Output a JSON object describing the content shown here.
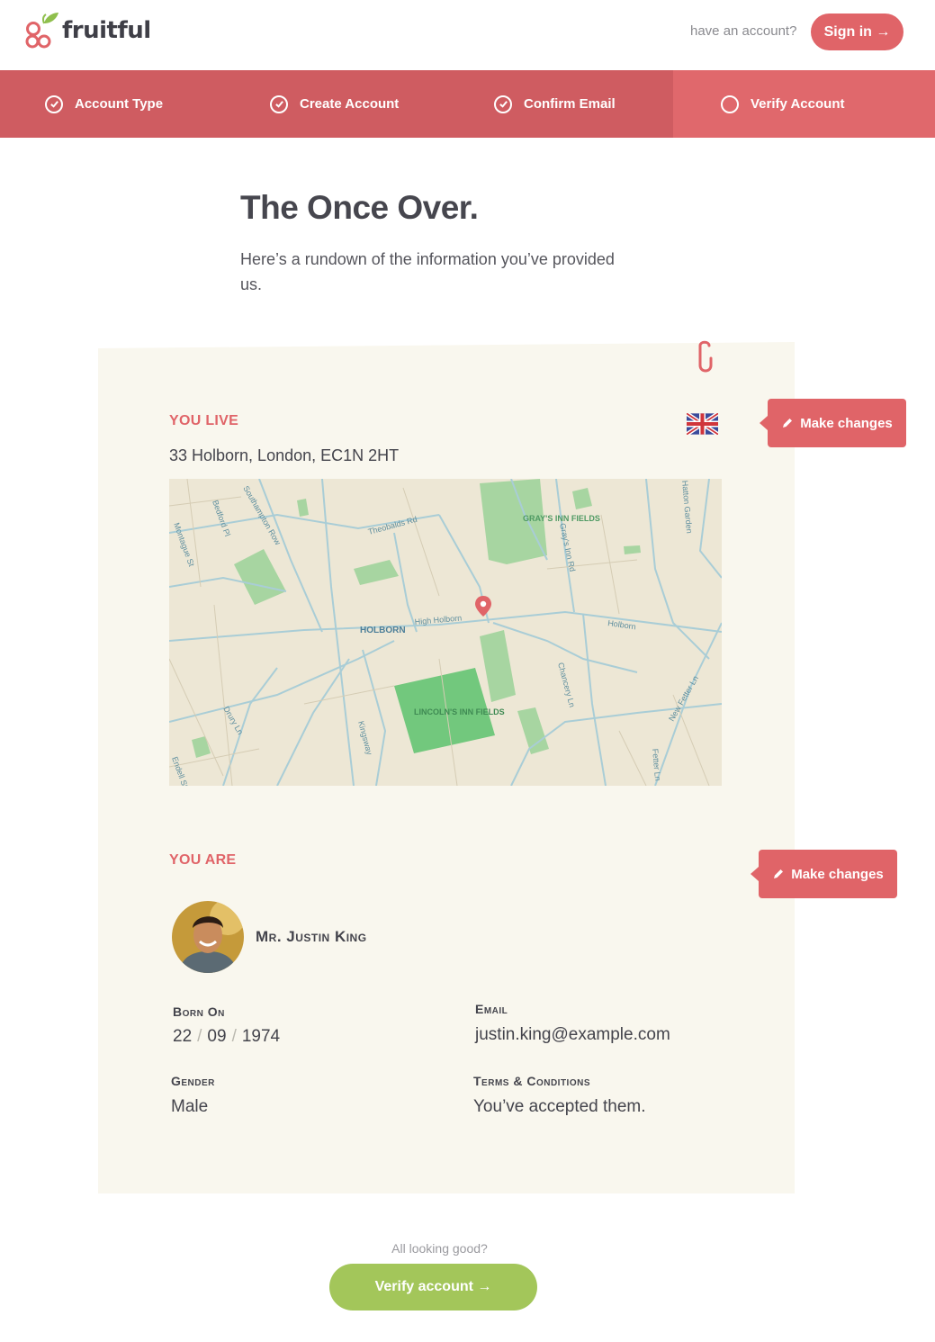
{
  "brand": {
    "name": "fruitful",
    "accent": "#e06468",
    "green": "#a3c65a"
  },
  "header": {
    "have_account": "have an account?",
    "signin_label": "Sign in →"
  },
  "steps": [
    {
      "label": "Account Type",
      "done": true
    },
    {
      "label": "Create Account",
      "done": true
    },
    {
      "label": "Confirm Email",
      "done": true
    },
    {
      "label": "Verify Account",
      "done": false
    }
  ],
  "intro": {
    "title": "The Once Over.",
    "text": "Here’s a rundown of the information you’ve provided us."
  },
  "location": {
    "label": "YOU LIVE",
    "address": "33 Holborn, London, EC1N 2HT",
    "flag": "uk-flag-icon",
    "edit_label": "Make changes",
    "map": {
      "places": [
        "GRAY'S INN FIELDS",
        "HOLBORN",
        "LINCOLN'S INN FIELDS"
      ],
      "streets": [
        "Theobalds Rd",
        "Southampton Row",
        "Bedford Pl",
        "Montague St",
        "High Holborn",
        "Gray's Inn Rd",
        "Holborn",
        "Kingsway",
        "Drury Ln",
        "Chancery Ln",
        "New Fetter Ln",
        "Fetter Ln",
        "Endell St",
        "Hatton Garden"
      ]
    }
  },
  "identity": {
    "label": "YOU ARE",
    "edit_label": "Make changes",
    "name": "Mr. Justin King",
    "born_label": "Born On",
    "dob": {
      "day": "22",
      "month": "09",
      "year": "1974",
      "sep": "/"
    },
    "email_label": "Email",
    "email": "justin.king@example.com",
    "gender_label": "Gender",
    "gender": "Male",
    "terms_label": "Terms & Conditions",
    "terms": "You’ve accepted them."
  },
  "footer": {
    "prompt": "All looking good?",
    "verify_label": "Verify account →"
  }
}
